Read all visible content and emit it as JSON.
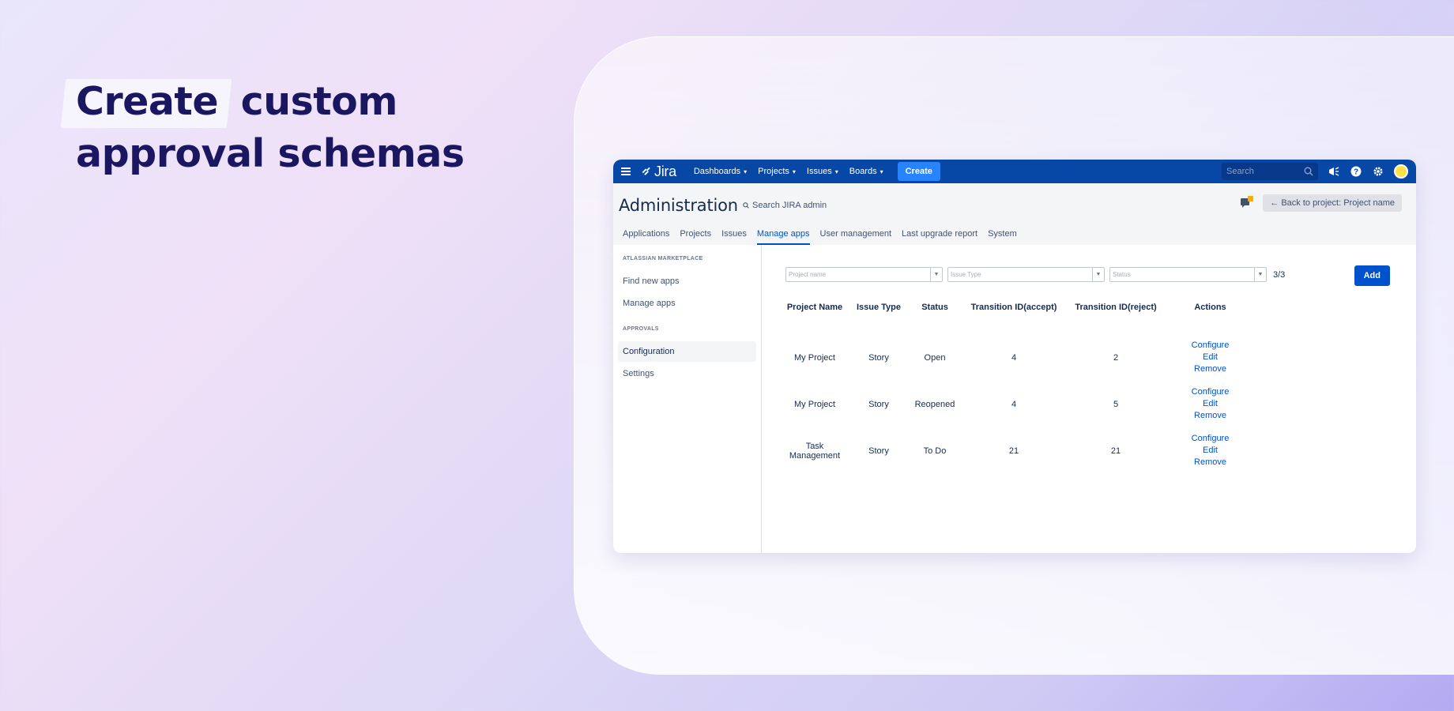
{
  "hero": {
    "highlight": "Create",
    "line1_rest": " custom",
    "line2": "approval schemas"
  },
  "topnav": {
    "logo": "Jira",
    "items": [
      "Dashboards",
      "Projects",
      "Issues",
      "Boards"
    ],
    "create_label": "Create",
    "search_placeholder": "Search",
    "brand_color": "#0747a6"
  },
  "admin": {
    "title": "Administration",
    "search_label": "Search JIRA admin",
    "back_button": "← Back to project: Project name",
    "tabs": [
      "Applications",
      "Projects",
      "Issues",
      "Manage apps",
      "User management",
      "Last upgrade report",
      "System"
    ],
    "active_tab": "Manage apps"
  },
  "sidebar": {
    "section1": "ATLASSIAN MARKETPLACE",
    "items1": [
      "Find new apps",
      "Manage apps"
    ],
    "section2": "APPROVALS",
    "items2": [
      "Configuration",
      "Settings"
    ],
    "active": "Configuration"
  },
  "filters": {
    "project_placeholder": "Project name",
    "issue_type_placeholder": "Issue Type",
    "status_placeholder": "Status",
    "count": "3/3",
    "add_label": "Add"
  },
  "table": {
    "headers": [
      "Project Name",
      "Issue Type",
      "Status",
      "Transition ID(accept)",
      "Transition ID(reject)",
      "Actions"
    ],
    "rows": [
      {
        "project": "My Project",
        "issue_type": "Story",
        "status": "Open",
        "accept": "4",
        "reject": "2"
      },
      {
        "project": "My Project",
        "issue_type": "Story",
        "status": "Reopened",
        "accept": "4",
        "reject": "5"
      },
      {
        "project": "Task Management",
        "issue_type": "Story",
        "status": "To Do",
        "accept": "21",
        "reject": "21"
      }
    ],
    "actions": [
      "Configure",
      "Edit",
      "Remove"
    ]
  }
}
